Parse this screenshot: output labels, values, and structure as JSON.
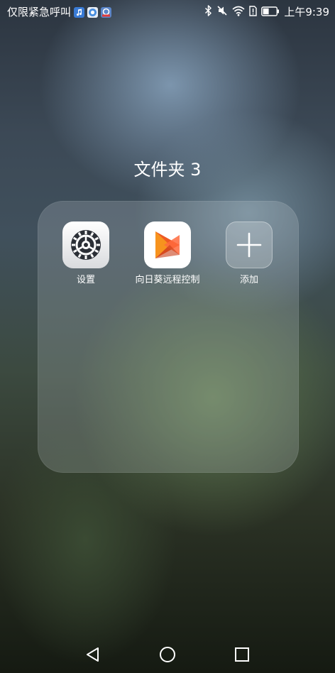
{
  "status_bar": {
    "carrier_text": "仅限紧急呼叫",
    "time": "上午9:39",
    "notification_icons": [
      "music-notification-icon",
      "browser-notification-icon",
      "app-notification-icon"
    ],
    "status_icons": [
      "bluetooth-icon",
      "silent-icon",
      "wifi-icon",
      "sim-alert-icon",
      "battery-icon"
    ]
  },
  "folder": {
    "title": "文件夹 3",
    "apps": [
      {
        "label": "设置",
        "icon": "settings-gear-icon"
      },
      {
        "label": "向日葵远程控制",
        "icon": "sunflower-remote-icon"
      },
      {
        "label": "添加",
        "icon": "add-plus-icon"
      }
    ]
  },
  "nav_bar": {
    "buttons": [
      "back-triangle-icon",
      "home-circle-icon",
      "recents-square-icon"
    ]
  },
  "colors": {
    "text": "#ffffff",
    "sunflower_orange": "#ee5a24",
    "settings_dark": "#2b2f36"
  }
}
